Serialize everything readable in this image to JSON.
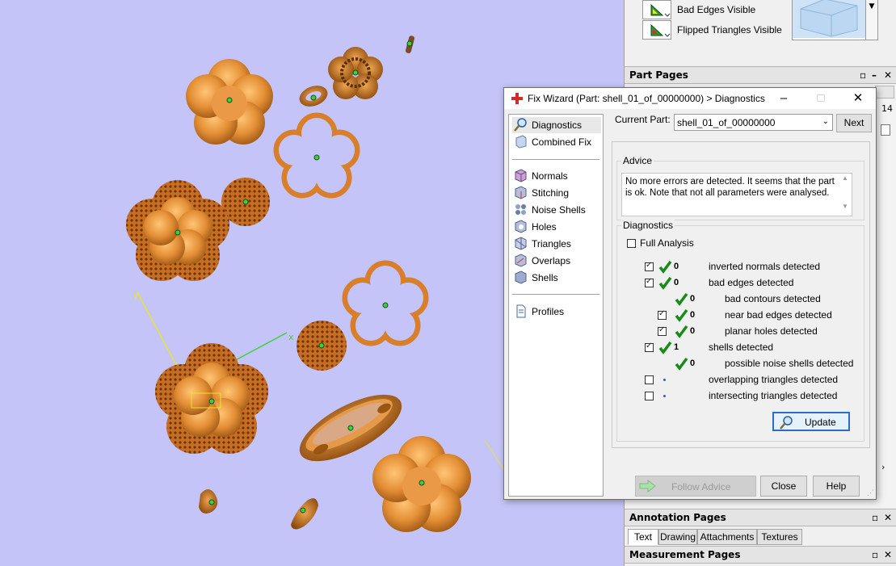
{
  "visibility": {
    "bad_edges_label": "Bad Edges Visible",
    "flipped_label": "Flipped Triangles Visible"
  },
  "part_pages": {
    "title": "Part Pages",
    "partial_tab_count": "14"
  },
  "annotation_pages": {
    "title": "Annotation Pages",
    "tabs": [
      "Text",
      "Drawing",
      "Attachments",
      "Textures"
    ]
  },
  "measurement_pages": {
    "title": "Measurement Pages"
  },
  "viewport": {
    "axis_x": "x",
    "axis_y": "y",
    "axis_z": "z",
    "colors": {
      "background": "#c4c4f8",
      "part": "#e48f36",
      "x_axis": "#3ad33a",
      "y_axis": "#e6e62a",
      "z_axis": "#e03232"
    }
  },
  "dialog": {
    "title": "Fix Wizard (Part: shell_01_of_00000000) > Diagnostics",
    "nav": {
      "top": [
        {
          "label": "Diagnostics",
          "icon": "magnifier-icon"
        },
        {
          "label": "Combined Fix",
          "icon": "combined-fix-icon"
        }
      ],
      "tools": [
        {
          "label": "Normals",
          "icon": "normals-icon"
        },
        {
          "label": "Stitching",
          "icon": "stitching-icon"
        },
        {
          "label": "Noise Shells",
          "icon": "noise-shells-icon"
        },
        {
          "label": "Holes",
          "icon": "holes-icon"
        },
        {
          "label": "Triangles",
          "icon": "triangles-icon"
        },
        {
          "label": "Overlaps",
          "icon": "overlaps-icon"
        },
        {
          "label": "Shells",
          "icon": "shells-icon"
        }
      ],
      "profiles": {
        "label": "Profiles",
        "icon": "document-icon"
      }
    },
    "current_part_label": "Current Part:",
    "current_part_value": "shell_01_of_00000000",
    "next_label": "Next",
    "advice_title": "Advice",
    "advice_text": "No more errors are detected. It seems that the part is ok. Note that not all parameters were analysed.",
    "diagnostics_title": "Diagnostics",
    "full_analysis_label": "Full Analysis",
    "rows": [
      {
        "count": "0",
        "label": "inverted normals detected"
      },
      {
        "count": "0",
        "label": "bad edges detected"
      },
      {
        "count": "0",
        "label": "bad contours detected"
      },
      {
        "count": "0",
        "label": "near bad edges detected"
      },
      {
        "count": "0",
        "label": "planar holes detected"
      },
      {
        "count": "1",
        "label": "shells detected"
      },
      {
        "count": "0",
        "label": "possible noise shells detected"
      },
      {
        "count": "",
        "label": "overlapping triangles detected"
      },
      {
        "count": "",
        "label": "intersecting triangles detected"
      }
    ],
    "update_label": "Update",
    "follow_advice_label": "Follow Advice",
    "close_label": "Close",
    "help_label": "Help"
  }
}
